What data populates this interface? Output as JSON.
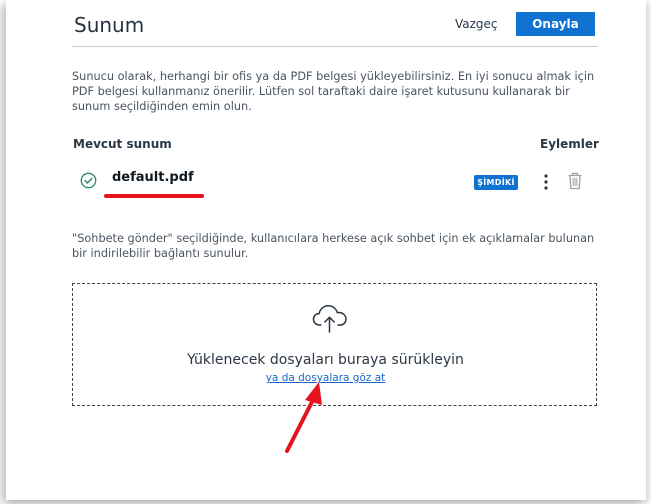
{
  "dialog": {
    "title": "Sunum",
    "cancel_label": "Vazgeç",
    "confirm_label": "Onayla"
  },
  "description": "Sunucu olarak, herhangi bir ofis ya da PDF belgesi yükleyebilirsiniz. En iyi sonucu almak için PDF belgesi kullanmanız önerilir. Lütfen sol taraftaki daire işaret kutusunu kullanarak bir sunum seçildiğinden emin olun.",
  "table": {
    "current_header": "Mevcut sunum",
    "actions_header": "Eylemler",
    "rows": [
      {
        "filename": "default.pdf",
        "badge": "ŞİMDİKİ",
        "check_icon": "check-circle-icon",
        "more_icon": "more-vertical-icon",
        "delete_icon": "trash-icon"
      }
    ]
  },
  "note": "\"Sohbete gönder\" seçildiğinde, kullanıcılara herkese açık sohbet için ek açıklamalar bulunan bir indirilebilir bağlantı sunulur.",
  "upload": {
    "icon": "cloud-upload-icon",
    "drop_text": "Yüklenecek dosyaları buraya sürükleyin",
    "browse_link": "ya da dosyalara göz at"
  },
  "colors": {
    "primary": "#0f71d0",
    "annotation": "#e5131b",
    "check": "#2e8a70"
  }
}
